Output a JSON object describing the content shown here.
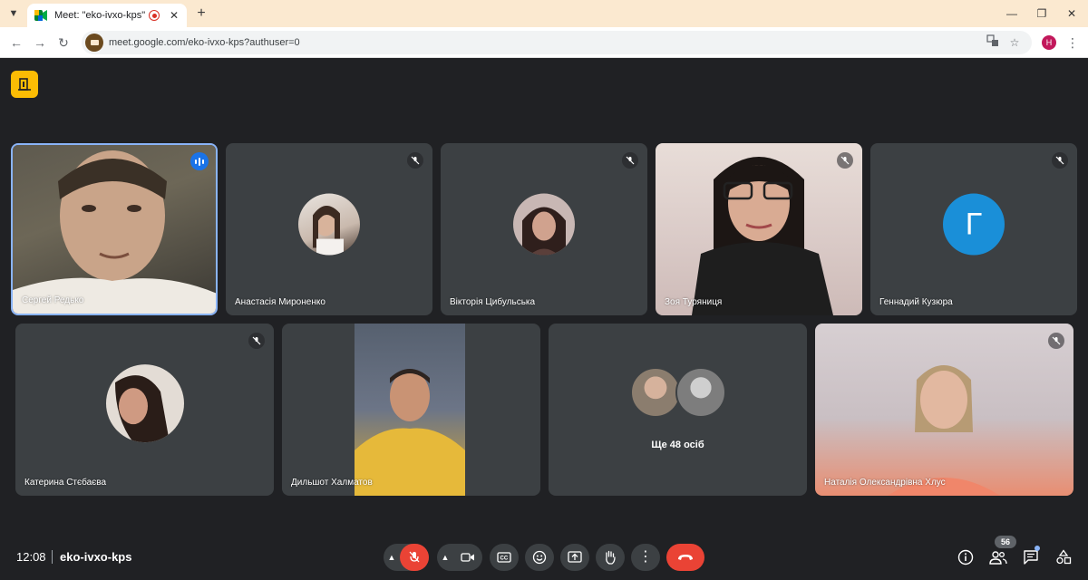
{
  "browser": {
    "tab_title": "Meet: \"eko-ivxo-kps\"",
    "url": "meet.google.com/eko-ivxo-kps?authuser=0",
    "profile_initial": "H"
  },
  "meeting": {
    "time": "12:08",
    "code": "eko-ivxo-kps",
    "participant_count": "56"
  },
  "participants": [
    {
      "name": "Сергей Редько",
      "state": "speaking",
      "display": "video"
    },
    {
      "name": "Анастасія Мироненко",
      "state": "muted",
      "display": "photo-avatar"
    },
    {
      "name": "Вікторія Цибульська",
      "state": "muted",
      "display": "photo-avatar"
    },
    {
      "name": "Зоя Туряниця",
      "state": "muted",
      "display": "video"
    },
    {
      "name": "Геннадий Кузюра",
      "state": "muted",
      "display": "letter-avatar",
      "letter": "Г"
    },
    {
      "name": "Катерина Стєбаєва",
      "state": "muted",
      "display": "photo-avatar"
    },
    {
      "name": "Дильшот Халматов",
      "state": "unmuted",
      "display": "video"
    },
    {
      "name": "Наталія Олександрівна Хлус",
      "state": "muted",
      "display": "video"
    }
  ],
  "more_tile": {
    "label": "Ще 48 осіб"
  },
  "colors": {
    "background": "#202124",
    "tile": "#3c4043",
    "danger": "#ea4335",
    "active_border": "#8ab4f8",
    "accent_blue": "#1a73e8",
    "host_badge": "#fbbc04"
  }
}
